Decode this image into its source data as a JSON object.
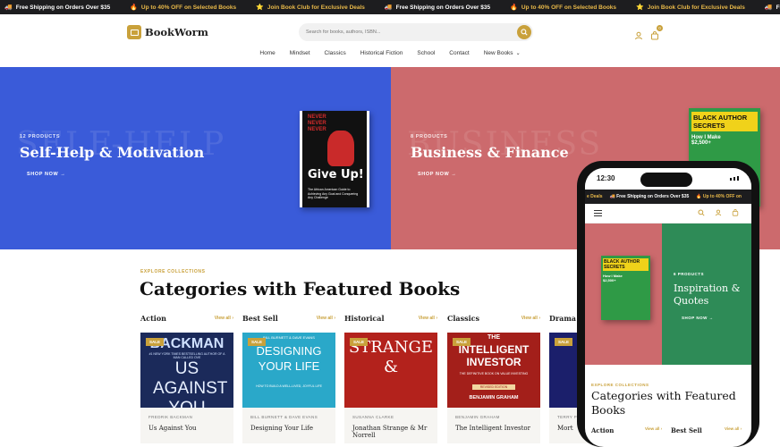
{
  "marquee": {
    "items": [
      {
        "icon": "truck-icon",
        "glyph": "🚚",
        "text": "Free Shipping on Orders Over $35",
        "style": "normal"
      },
      {
        "icon": "fire-icon",
        "glyph": "🔥",
        "text": "Up to 40% OFF on Selected Books",
        "style": "promo"
      },
      {
        "icon": "star-icon",
        "glyph": "⭐",
        "text": "Join Book Club for Exclusive Deals",
        "style": "promo"
      },
      {
        "icon": "truck-icon",
        "glyph": "🚚",
        "text": "Free Shipping on Orders Over $35",
        "style": "normal"
      },
      {
        "icon": "fire-icon",
        "glyph": "🔥",
        "text": "Up to 40% OFF on Selected Books",
        "style": "promo"
      },
      {
        "icon": "star-icon",
        "glyph": "⭐",
        "text": "Join Book Club for Exclusive Deals",
        "style": "promo"
      },
      {
        "icon": "truck-icon",
        "glyph": "🚚",
        "text": "Free Shipping on Orders Over $35",
        "style": "normal"
      }
    ]
  },
  "header": {
    "logo": "BookWorm",
    "search_placeholder": "Search for books, authors, ISBN...",
    "cart_count": "0"
  },
  "nav": [
    "Home",
    "Mindset",
    "Classics",
    "Historical Fiction",
    "School",
    "Contact"
  ],
  "nav_dropdown": "New Books",
  "hero": {
    "left": {
      "watermark": "SELF-HELP",
      "count": "12 PRODUCTS",
      "title": "Self-Help & Motivation",
      "shop": "SHOP NOW",
      "book_top": "NEVER NEVER NEVER",
      "book_title": "Give Up!",
      "book_sub": "The African American Guide to Achieving Any Goal and Conquering Any Challenge"
    },
    "right": {
      "watermark": "BUSINESS",
      "count": "8 PRODUCTS",
      "title": "Business & Finance",
      "shop": "SHOP NOW",
      "book_title": "BLACK AUTHOR SECRETS",
      "book_sub": "How I Make $2,500+"
    }
  },
  "collections": {
    "eyebrow": "EXPLORE COLLECTIONS",
    "title": "Categories with Featured Books",
    "view_all": "View all ›",
    "columns": [
      {
        "name": "Action",
        "sale": "SALE",
        "author": "FREDRIK BACKMAN",
        "title": "Us Against You",
        "cover_top": "BACKMAN",
        "cover_sub": "#1 NEW YORK TIMES BESTSELLING AUTHOR OF A MAN CALLED OVE",
        "cover_main": "US AGAINST YOU"
      },
      {
        "name": "Best Sell",
        "sale": "SALE",
        "author": "BILL BURNETT & DAVE EVANS",
        "title": "Designing Your Life",
        "cover_top": "BILL BURNETT & DAVE EVANS",
        "cover_sub": "HOW TO BUILD A WELL-LIVED, JOYFUL LIFE",
        "cover_main": "DESIGNING YOUR LIFE"
      },
      {
        "name": "Historical",
        "sale": "SALE",
        "author": "SUSANNA CLARKE",
        "title": "Jonathan Strange & Mr Norrell",
        "cover_top": "",
        "cover_sub": "",
        "cover_main": "STRANGE &"
      },
      {
        "name": "Classics",
        "sale": "SALE",
        "author": "BENJAMIN GRAHAM",
        "title": "The Intelligent Investor",
        "cover_top": "THE",
        "cover_sub": "THE DEFINITIVE BOOK ON VALUE INVESTING",
        "cover_main": "INTELLIGENT INVESTOR",
        "cover_extra": "REVISED EDITION",
        "cover_author": "BENJAMIN GRAHAM"
      },
      {
        "name": "Drama",
        "sale": "SALE",
        "author": "TERRY PRATCHETT",
        "title": "Mort",
        "cover_top": "",
        "cover_sub": "",
        "cover_main": ""
      }
    ]
  },
  "phone": {
    "time": "12:30",
    "marquee": [
      "e Deals",
      "🚚 Free Shipping on Orders Over $35",
      "🔥 Up to 40% OFF on"
    ],
    "hero_count": "6 PRODUCTS",
    "hero_title": "Inspiration & Quotes",
    "hero_shop": "SHOP NOW",
    "eyebrow": "EXPLORE COLLECTIONS",
    "title": "Categories with Featured Books",
    "col1": "Action",
    "col2": "Best Sell",
    "view_all": "View all ›"
  },
  "colors": {
    "accent": "#c9a13b",
    "hero_left": "#3a5bd9",
    "hero_right": "#cc6a6d",
    "phone_green": "#2e8b57",
    "dark": "#1d1d1f"
  }
}
